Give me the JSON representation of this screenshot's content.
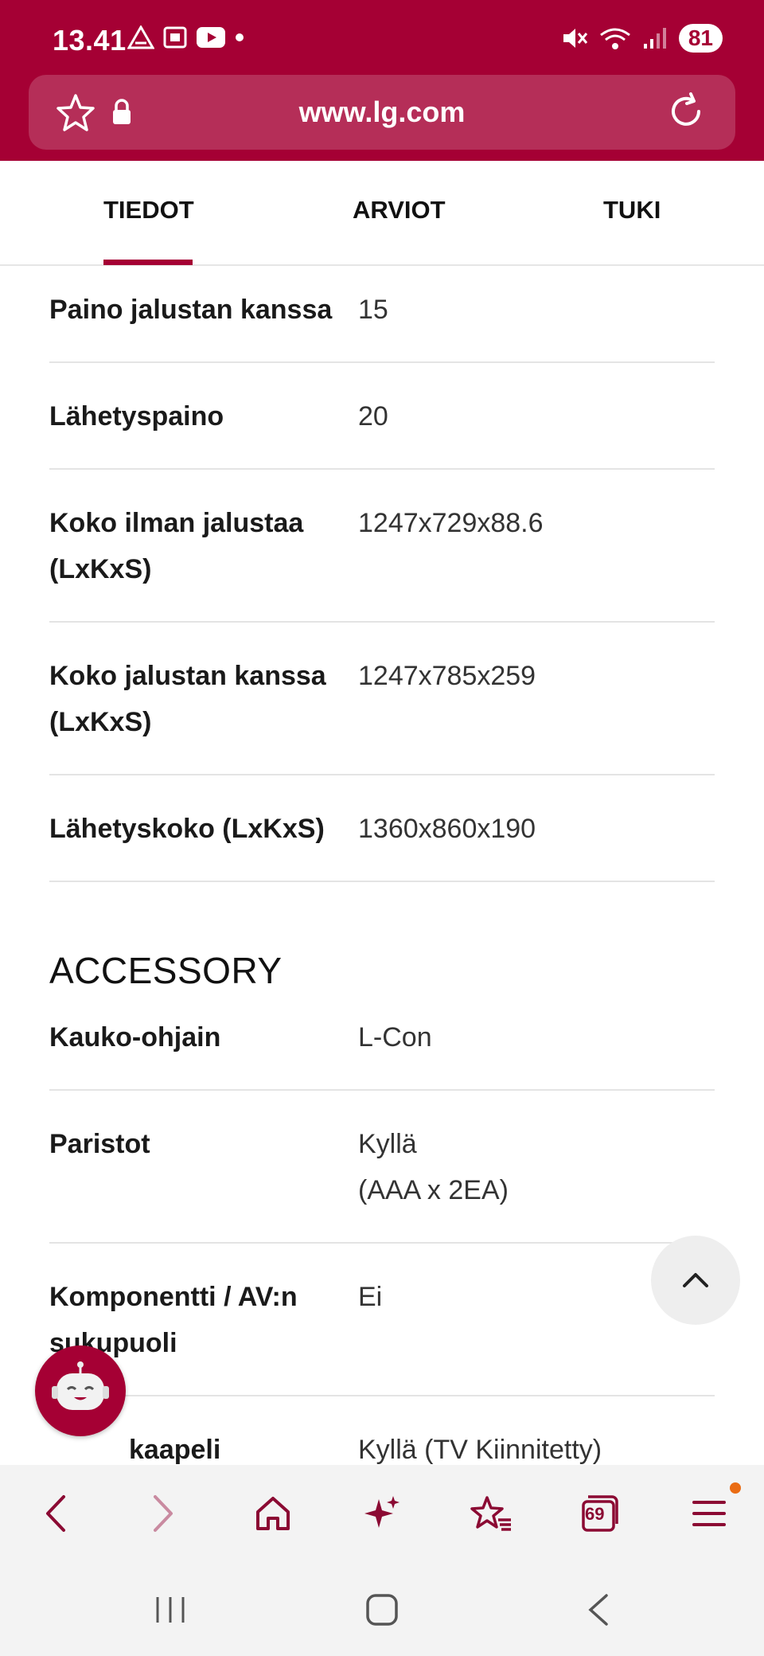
{
  "status": {
    "time": "13.41",
    "battery": "81",
    "network": "5"
  },
  "browser": {
    "url": "www.lg.com",
    "tab_count": "69"
  },
  "tabs": [
    {
      "label": "TIEDOT",
      "active": true
    },
    {
      "label": "ARVIOT",
      "active": false
    },
    {
      "label": "TUKI",
      "active": false
    }
  ],
  "specs_dimensions": [
    {
      "key": "Paino jalustan kanssa",
      "value": "15"
    },
    {
      "key": "Lähetyspaino",
      "value": "20"
    },
    {
      "key": "Koko ilman jalustaa (LxKxS)",
      "value": "1247x729x88.6"
    },
    {
      "key": "Koko jalustan kanssa (LxKxS)",
      "value": "1247x785x259"
    },
    {
      "key": "Lähetyskoko (LxKxS)",
      "value": "1360x860x190"
    }
  ],
  "accessory": {
    "title": "ACCESSORY",
    "rows": [
      {
        "key": "Kauko-ohjain",
        "value": "L-Con"
      },
      {
        "key": "Paristot",
        "value": "Kyllä",
        "value2": "(AAA x 2EA)"
      },
      {
        "key": "Komponentti / AV:n sukupuoli",
        "value": "Ei"
      },
      {
        "key": "kaapeli",
        "value": "Kyllä (TV Kiinnitetty)"
      }
    ]
  },
  "colors": {
    "brand": "#a50034",
    "nav_icon": "#8b0a33"
  }
}
